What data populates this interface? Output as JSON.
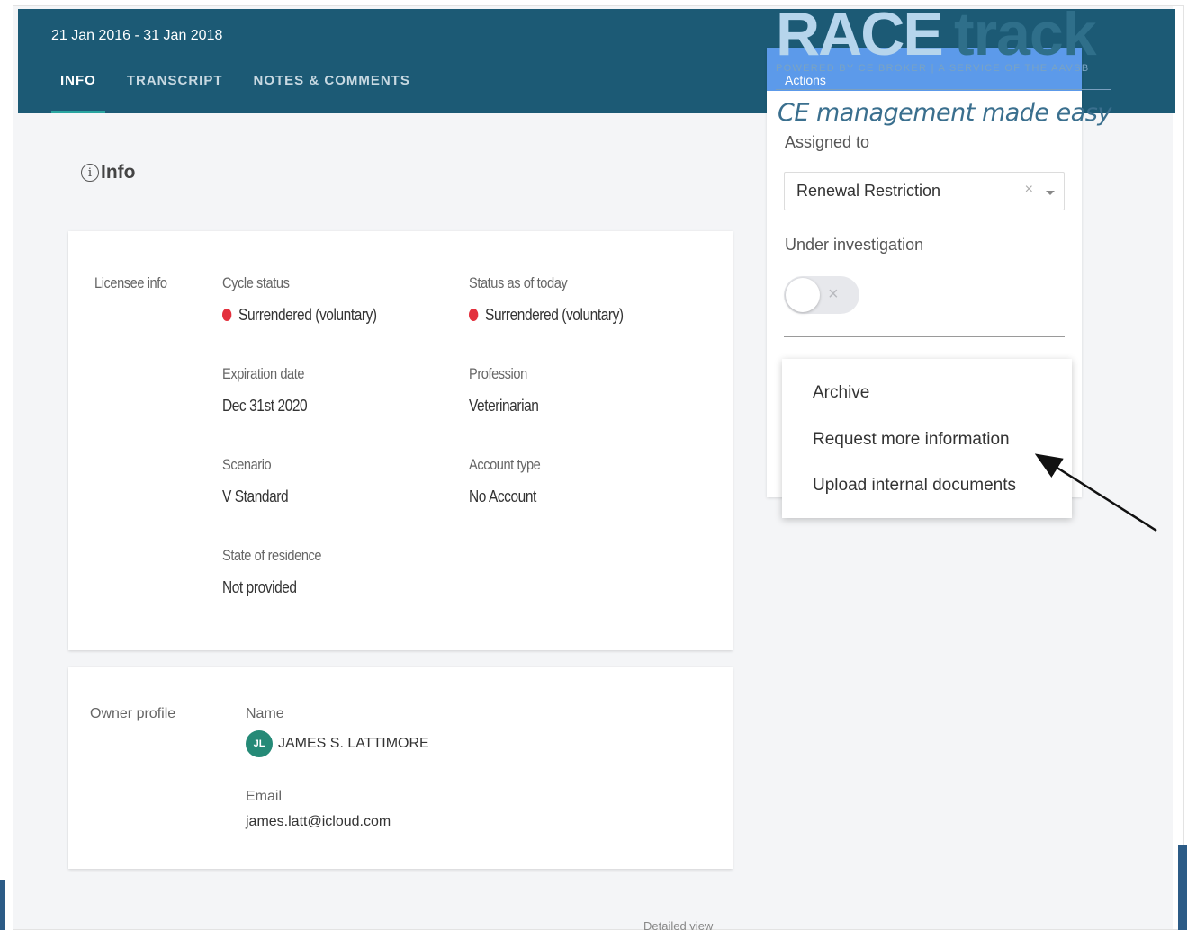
{
  "header": {
    "date_range": "21 Jan 2016 - 31 Jan 2018",
    "tabs": [
      {
        "label": "INFO",
        "active": true
      },
      {
        "label": "TRANSCRIPT",
        "active": false
      },
      {
        "label": "NOTES & COMMENTS",
        "active": false
      }
    ]
  },
  "main": {
    "section_title": "Info",
    "licensee": {
      "section_label": "Licensee info",
      "cycle_status_label": "Cycle status",
      "cycle_status_value": "Surrendered (voluntary)",
      "status_today_label": "Status as of today",
      "status_today_value": "Surrendered (voluntary)",
      "expiration_label": "Expiration date",
      "expiration_value": "Dec 31st 2020",
      "profession_label": "Profession",
      "profession_value": "Veterinarian",
      "scenario_label": "Scenario",
      "scenario_value": "V Standard",
      "account_type_label": "Account type",
      "account_type_value": "No Account",
      "state_label": "State of residence",
      "state_value": "Not provided"
    },
    "owner": {
      "section_label": "Owner profile",
      "name_label": "Name",
      "initials": "JL",
      "name_value": "JAMES S. LATTIMORE",
      "email_label": "Email",
      "email_value": "james.latt@icloud.com"
    },
    "detailed_view": "Detailed view"
  },
  "side_panel": {
    "actions_label": "Actions",
    "assigned_label": "Assigned to",
    "assigned_value": "Renewal Restriction",
    "clear_symbol": "×",
    "investigation_label": "Under investigation",
    "toggle_on": false,
    "toggle_symbol": "×"
  },
  "menu": {
    "items": [
      {
        "label": "Archive"
      },
      {
        "label": "Request more information"
      },
      {
        "label": "Upload internal documents"
      }
    ]
  },
  "logo": {
    "race": "RACE",
    "track": "track",
    "powered_by": "POWERED BY CE BROKER | A SERVICE OF THE AAVSB",
    "tagline": "CE management made easy"
  },
  "colors": {
    "header_bg": "#1c5a75",
    "tab_indicator": "#2aa5a0",
    "status_dot": "#e3303d",
    "avatar_bg": "#258a77",
    "actions_header": "#4a8fe8"
  }
}
